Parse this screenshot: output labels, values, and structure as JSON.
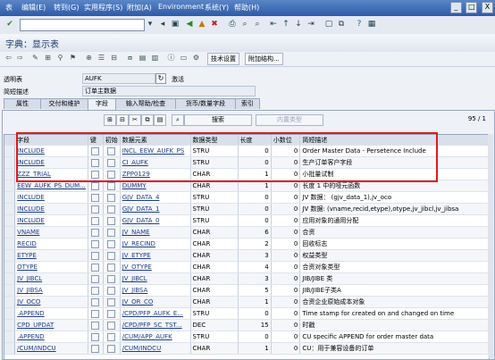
{
  "menubar": {
    "items": [
      "表",
      "编辑(E)",
      "转到(G)",
      "实用程序(S)",
      "附加(A)",
      "Environment",
      "系统(Y)",
      "帮助(H)"
    ],
    "window_buttons": [
      "_",
      "□",
      "X"
    ]
  },
  "title": "字典：显示表",
  "app_toolbar": {
    "tech_settings_label": "技术设置",
    "append_label": "附加结构..."
  },
  "header": {
    "table_label": "透明表",
    "table_value": "AUFK",
    "status_value": "激活",
    "desc_label": "简短描述",
    "desc_value": "订单主数据"
  },
  "tabs": [
    {
      "label": "属性",
      "active": false
    },
    {
      "label": "交付和维护",
      "active": false
    },
    {
      "label": "字段",
      "active": true
    },
    {
      "label": "输入帮助/检查",
      "active": false
    },
    {
      "label": "货币/数量字段",
      "active": false
    },
    {
      "label": "索引",
      "active": false
    }
  ],
  "grid_toolbar": {
    "search_label": "搜索",
    "builtin_label": "内置类型",
    "pager": "95 / 1"
  },
  "table": {
    "columns": [
      "字段",
      "键",
      "初始",
      "数据元素",
      "数据类型",
      "长度",
      "小数位",
      "简短描述"
    ],
    "rows": [
      [
        "INCLUDE",
        "",
        "",
        "INCL_EEW_AUFK_PS",
        "STRU",
        "0",
        "0",
        "Order Master Data - Persetence Include"
      ],
      [
        "INCLUDE",
        "",
        "",
        "CI_AUFK",
        "STRU",
        "0",
        "0",
        "生产订单客户字段"
      ],
      [
        "ZZZ_TRIAL",
        "",
        "",
        "ZPP0129",
        "CHAR",
        "1",
        "0",
        "小批量试制"
      ],
      [
        "EEW_AUFK_PS_DUM...",
        "",
        "",
        "DUMMY",
        "CHAR",
        "1",
        "0",
        "长度 1 中的哑元函数"
      ],
      [
        "INCLUDE",
        "",
        "",
        "GJV_DATA_4",
        "STRU",
        "0",
        "0",
        "JV 数据： (gjv_data_1),jv_oco"
      ],
      [
        "INCLUDE",
        "",
        "",
        "GJV_DATA_1",
        "STRU",
        "0",
        "0",
        "JV 数据: (vname,recid,etype),otype,jv_jibcl,jv_jibsa"
      ],
      [
        "INCLUDE",
        "",
        "",
        "GJV_DATA_0",
        "STRU",
        "0",
        "0",
        "应用对象的通用分配"
      ],
      [
        "VNAME",
        "",
        "",
        "JV_NAME",
        "CHAR",
        "6",
        "0",
        "合资"
      ],
      [
        "RECID",
        "",
        "",
        "JV_RECIND",
        "CHAR",
        "2",
        "0",
        "回收标志"
      ],
      [
        "ETYPE",
        "",
        "",
        "JV_ETYPE",
        "CHAR",
        "3",
        "0",
        "权益类型"
      ],
      [
        "OTYPE",
        "",
        "",
        "JV_OTYPE",
        "CHAR",
        "4",
        "0",
        "合资对象类型"
      ],
      [
        "JV_JIBCL",
        "",
        "",
        "JV_JIBCL",
        "CHAR",
        "3",
        "0",
        "JIB/JIBE 类"
      ],
      [
        "JV_JIBSA",
        "",
        "",
        "JV_JIBSA",
        "CHAR",
        "5",
        "0",
        "JIB/JIBE子类A"
      ],
      [
        "JV_OCO",
        "",
        "",
        "JV_OR_CO",
        "CHAR",
        "1",
        "0",
        "合资企业原始成本对象"
      ],
      [
        ".APPEND",
        "",
        "",
        "/CPD/PFP_AUFK_E...",
        "STRU",
        "0",
        "0",
        "Time stamp for created on and changed on time"
      ],
      [
        "CPD_UPDAT",
        "",
        "",
        "/CPD/PFP_SC_TST...",
        "DEC",
        "15",
        "0",
        "时戳"
      ],
      [
        ".APPEND",
        "",
        "",
        "/CUM/APP_AUFK",
        "STRU",
        "0",
        "0",
        "CU specific APPEND for order master data"
      ],
      [
        "/CUM/INDCU",
        "",
        "",
        "/CUM/INDCU",
        "CHAR",
        "1",
        "0",
        "CU：用于兼容设备的订单"
      ]
    ]
  },
  "colors": {
    "highlight_box": "#e01a1a",
    "link": "#1b3c86",
    "menubar": "#2d5aa8"
  }
}
